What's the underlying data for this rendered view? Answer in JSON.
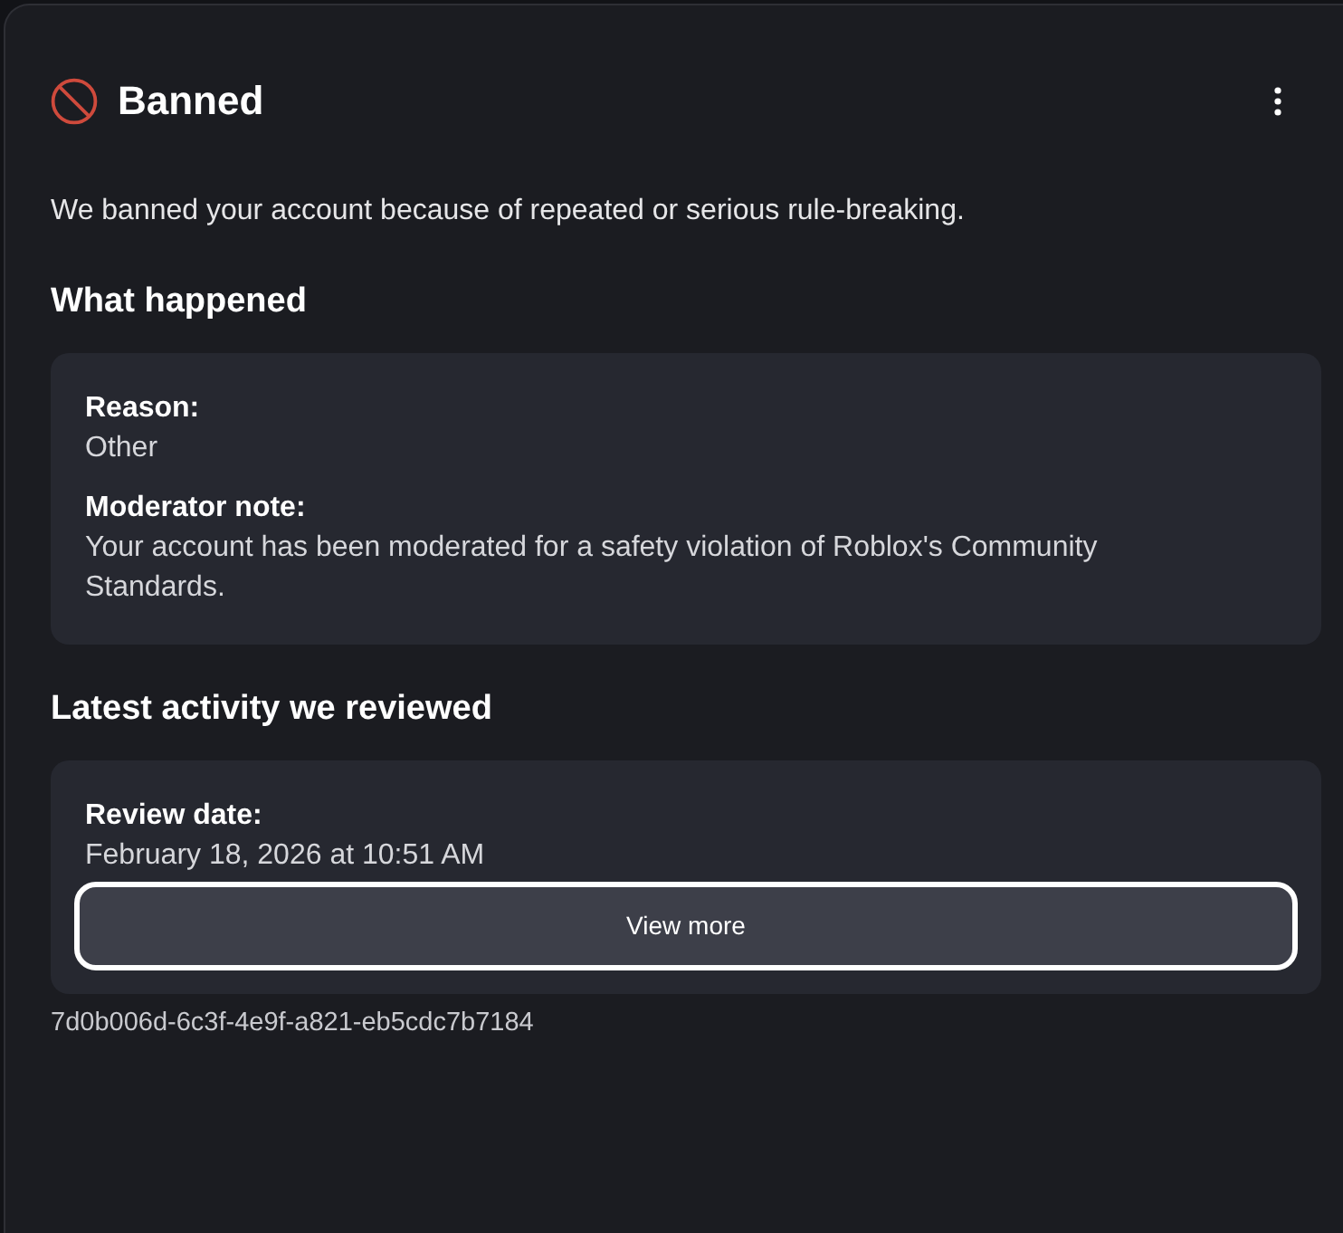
{
  "title": "Banned",
  "description": "We banned your account because of repeated or serious rule-breaking.",
  "sections": [
    {
      "heading": "What happened",
      "fields": [
        {
          "label": "Reason:",
          "value": "Other"
        },
        {
          "label": "Moderator note:",
          "value": "Your account has been moderated for a safety violation of Roblox's Community Standards."
        }
      ]
    },
    {
      "heading": "Latest activity we reviewed",
      "fields": [
        {
          "label": "Review date:",
          "value": "February 18, 2026 at 10:51 AM"
        }
      ],
      "button": {
        "label": "View more",
        "focused": true
      }
    }
  ],
  "reference_id": "7d0b006d-6c3f-4e9f-a821-eb5cdc7b7184"
}
